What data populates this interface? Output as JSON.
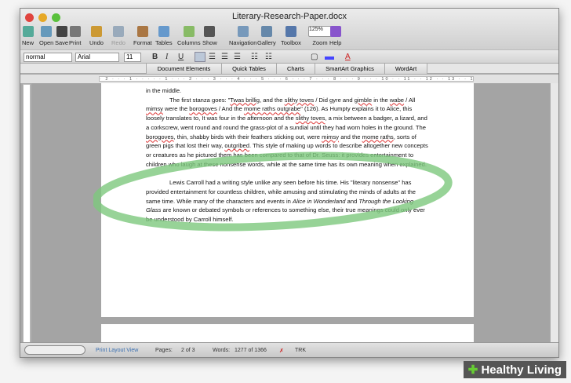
{
  "window": {
    "title": "Literary-Research-Paper.docx"
  },
  "toolbar": {
    "items": [
      "New",
      "Open",
      "Save",
      "Print",
      "Undo",
      "Redo",
      "Format",
      "Tables",
      "Columns",
      "Show",
      "Navigation",
      "Gallery",
      "Toolbox",
      "Zoom",
      "Help"
    ],
    "zoom_value": "125%"
  },
  "format_bar": {
    "style": "normal",
    "font": "Arial",
    "size": "11",
    "bold": "B",
    "italic": "I",
    "underline": "U",
    "font_color": "A"
  },
  "ribbon": {
    "tabs": [
      "Document Elements",
      "Quick Tables",
      "Charts",
      "SmartArt Graphics",
      "WordArt"
    ]
  },
  "ruler": {
    "marks": "· 2 · · · 1 · · · · · 1 · · · 2 · · · 3 · · · 4 · · · 5 · · · 6 · · · 7 · · · 8 · · · 9 · · · 10 · · 11 · · 12 · · 13 · · 14 · · 15 · · 16 · · 17 · · 18 · · 19"
  },
  "document": {
    "p0": "in the middle.",
    "p1": [
      {
        "t": "The first stanza goes: \""
      },
      {
        "t": "Twas brillig",
        "u": 1
      },
      {
        "t": ", and the "
      },
      {
        "t": "slithy toves",
        "u": 1
      },
      {
        "t": " / Did gyre and "
      },
      {
        "t": "gimble",
        "u": 1
      },
      {
        "t": " in the "
      },
      {
        "t": "wabe",
        "u": 1
      },
      {
        "t": " / All "
      },
      {
        "t": "mimsy",
        "u": 1
      },
      {
        "t": " were the "
      },
      {
        "t": "borogoves",
        "u": 1
      },
      {
        "t": " / And the "
      },
      {
        "t": "mome raths outgrabe",
        "u": 1
      },
      {
        "t": "\" (126). As Humpty explains it to Alice, this loosely translates to, It was four in the afternoon and the "
      },
      {
        "t": "slithy toves",
        "u": 1
      },
      {
        "t": ", a mix between a badger, a lizard, and a corkscrew, went round and round the grass-plot of a sundial until they had worn holes in the ground. The "
      },
      {
        "t": "borogoves",
        "u": 1
      },
      {
        "t": ", thin, shabby birds with their feathers sticking out, were "
      },
      {
        "t": "mimsy",
        "u": 1
      },
      {
        "t": " and the "
      },
      {
        "t": "mome raths",
        "u": 1
      },
      {
        "t": ", sorts of green pigs that lost their way, "
      },
      {
        "t": "outgribed",
        "u": 1
      },
      {
        "t": ". This style of making up words to describe altogether new concepts or creatures as he pictured them has been compared to that of Dr. Seuss: it provides entertainment to children who laugh at these nonsense words, while at the same time has its own meaning when explained."
      }
    ],
    "p2": [
      {
        "t": "Lewis Carroll had a writing style unlike any seen before his time. His \"literary nonsense\" has provided entertainment for countless children, while amusing and stimulating the minds of adults at the same time. While many of the characters and events in "
      },
      {
        "t": "Alice in Wonderland",
        "i": 1
      },
      {
        "t": " and "
      },
      {
        "t": "Through the Looking Glass",
        "i": 1
      },
      {
        "t": " are known or debated symbols or references to something else, their true meanings could only ever be understood by Carroll himself."
      }
    ]
  },
  "status": {
    "view": "Print Layout View",
    "pages_label": "Pages:",
    "pages_value": "2 of 3",
    "words_label": "Words:",
    "words_value": "1277 of 1366",
    "trk": "TRK"
  },
  "watermark": "Healthy Living",
  "colors": {
    "highlight": "#7dc87d",
    "status_view": "#3a6fb0"
  }
}
